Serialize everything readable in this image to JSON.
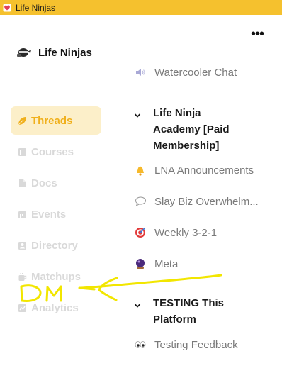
{
  "window": {
    "title": "Life Ninjas"
  },
  "sidebar": {
    "brand": "Life Ninjas",
    "items": [
      {
        "label": "Threads",
        "icon": "leaf-icon",
        "active": true
      },
      {
        "label": "Courses",
        "icon": "courses-icon",
        "active": false
      },
      {
        "label": "Docs",
        "icon": "doc-icon",
        "active": false
      },
      {
        "label": "Events",
        "icon": "calendar-icon",
        "active": false
      },
      {
        "label": "Directory",
        "icon": "directory-icon",
        "active": false
      },
      {
        "label": "Matchups",
        "icon": "coffee-icon",
        "active": false
      },
      {
        "label": "Analytics",
        "icon": "chart-icon",
        "active": false
      }
    ]
  },
  "main": {
    "channels_top": [
      {
        "label": "Watercooler Chat",
        "icon": "speaker-icon"
      }
    ],
    "group1": {
      "title": "Life Ninja Academy [Paid Membership]",
      "channels": [
        {
          "label": "LNA Announcements",
          "icon": "bell-icon"
        },
        {
          "label": "Slay Biz Overwhelm...",
          "icon": "speech-bubble-icon"
        },
        {
          "label": "Weekly 3-2-1",
          "icon": "target-icon"
        },
        {
          "label": "Meta",
          "icon": "crystal-ball-icon"
        }
      ]
    },
    "group2": {
      "title": "TESTING This Platform",
      "channels": [
        {
          "label": "Testing Feedback",
          "icon": "eyes-icon"
        }
      ]
    }
  },
  "annotation": {
    "text": "DM"
  },
  "colors": {
    "titlebar": "#f5c12e",
    "accent": "#f0b01c",
    "active_bg": "#fcefc9",
    "inactive_nav": "#d9d9d9",
    "highlighter": "#f2e600"
  }
}
